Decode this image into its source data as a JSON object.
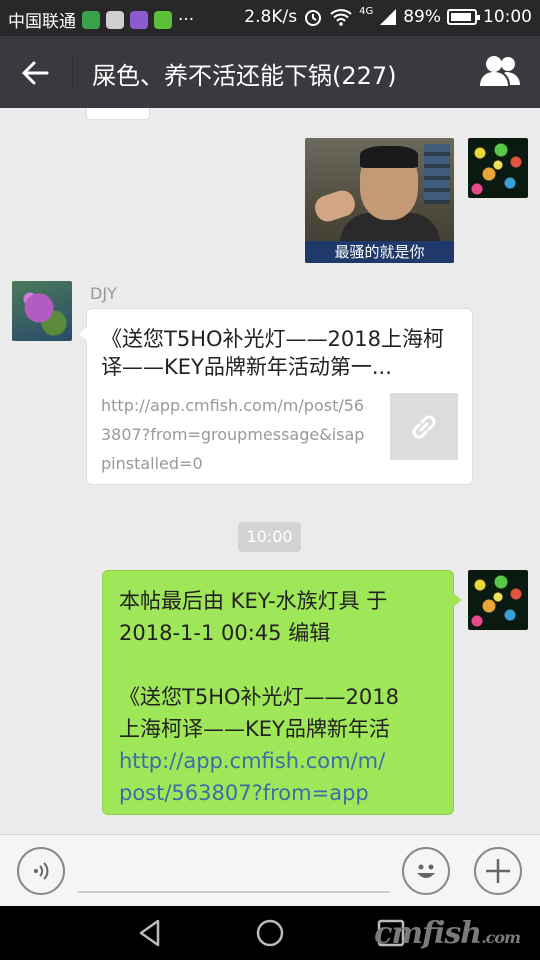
{
  "status_bar": {
    "carrier": "中国联通",
    "more": "···",
    "speed": "2.8K/s",
    "network": "4G",
    "battery": "89%",
    "battery_level": 0.89,
    "time": "10:00"
  },
  "header": {
    "title": "屎色、养不活还能下锅(227)",
    "back_icon": "back-arrow-icon",
    "members_icon": "group-members-icon"
  },
  "messages": [
    {
      "type": "image",
      "from": "me",
      "caption": "最骚的就是你"
    },
    {
      "type": "link",
      "sender": "DJY",
      "title": "《送您T5HO补光灯——2018上海柯译——KEY品牌新年活动第一...",
      "description": "http://app.cmfish.com/m/post/563807?from=groupmessage&isappinstalled=0",
      "thumb_icon": "link-icon"
    },
    {
      "type": "time",
      "label": "10:00"
    },
    {
      "type": "text",
      "from": "me",
      "line1": " 本帖最后由 KEY-水族灯具 于",
      "line2": "2018-1-1 00:45 编辑",
      "line3": "《送您T5HO补光灯——2018",
      "line4": "上海柯译——KEY品牌新年活",
      "link1": "http://app.cmfish.com/m/",
      "link2": "post/563807?from=app"
    }
  ],
  "input_bar": {
    "voice_icon": "voice-icon",
    "emoji_icon": "emoji-icon",
    "plus_icon": "plus-icon"
  },
  "nav_bar": {
    "back_icon": "nav-back-icon",
    "home_icon": "nav-home-icon",
    "recents_icon": "nav-recents-icon",
    "watermark_main": "cmfish",
    "watermark_suffix": ".com"
  },
  "colors": {
    "header_bg": "#393a3f",
    "chat_bg": "#ebebeb",
    "my_bubble": "#9fe658",
    "link_text": "#3b6ea8"
  }
}
